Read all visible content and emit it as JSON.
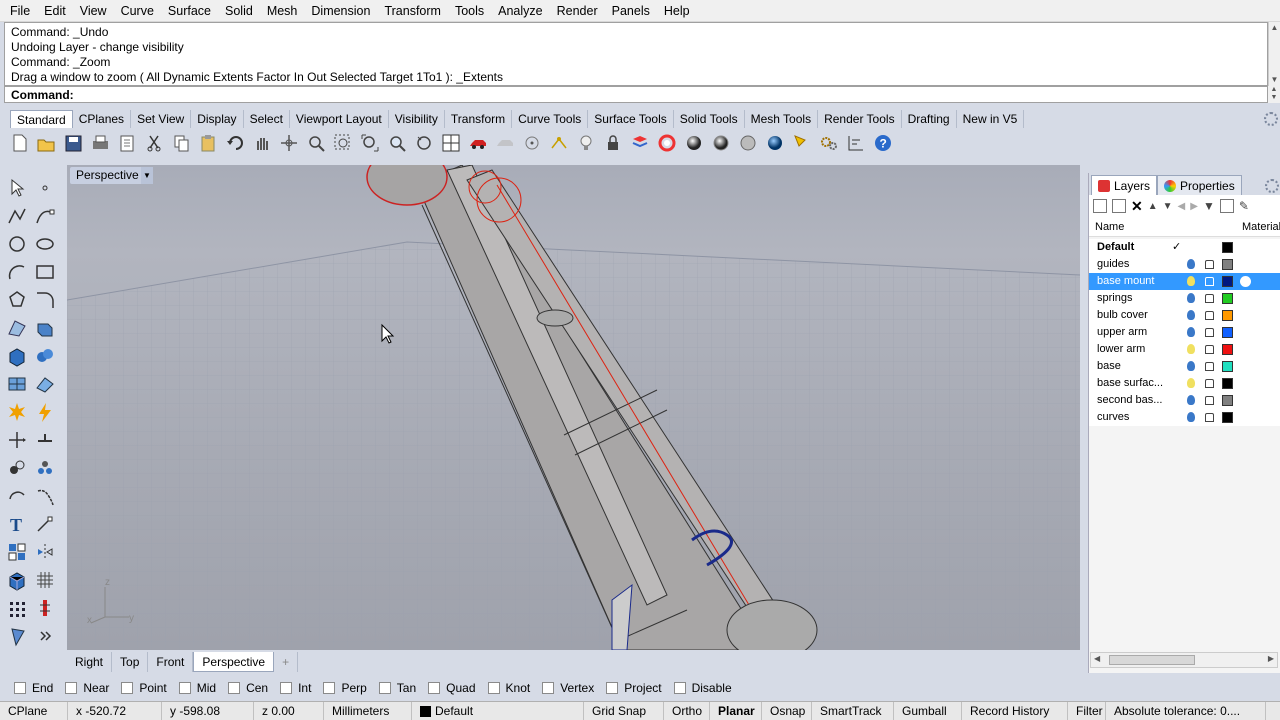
{
  "menu": [
    "File",
    "Edit",
    "View",
    "Curve",
    "Surface",
    "Solid",
    "Mesh",
    "Dimension",
    "Transform",
    "Tools",
    "Analyze",
    "Render",
    "Panels",
    "Help"
  ],
  "history": [
    "Command: _Undo",
    "Undoing Layer - change visibility",
    "Command: _Zoom",
    "Drag a window to zoom ( All  Dynamic  Extents  Factor  In  Out  Selected  Target  1To1 ): _Extents"
  ],
  "command_prompt": "Command:",
  "toolbar_tabs": [
    "Standard",
    "CPlanes",
    "Set View",
    "Display",
    "Select",
    "Viewport Layout",
    "Visibility",
    "Transform",
    "Curve Tools",
    "Surface Tools",
    "Solid Tools",
    "Mesh Tools",
    "Render Tools",
    "Drafting",
    "New in V5"
  ],
  "viewport": {
    "label": "Perspective",
    "dropdown": "▼"
  },
  "view_tabs": [
    "Right",
    "Top",
    "Front",
    "Perspective"
  ],
  "view_tab_add": "+",
  "osnaps": [
    "End",
    "Near",
    "Point",
    "Mid",
    "Cen",
    "Int",
    "Perp",
    "Tan",
    "Quad",
    "Knot",
    "Vertex",
    "Project",
    "Disable"
  ],
  "status": {
    "cplane": "CPlane",
    "x": "x -520.72",
    "y": "y -598.08",
    "z": "z 0.00",
    "units": "Millimeters",
    "layer": "Default",
    "grid_snap": "Grid Snap",
    "ortho": "Ortho",
    "planar": "Planar",
    "osnap": "Osnap",
    "smarttrack": "SmartTrack",
    "gumball": "Gumball",
    "record_history": "Record History",
    "filter": "Filter",
    "tolerance": "Absolute tolerance: 0...."
  },
  "panel": {
    "tabs": [
      "Layers",
      "Properties"
    ],
    "header_name": "Name",
    "header_material": "Material",
    "layers": [
      {
        "name": "Default",
        "bold": true,
        "check": "✓",
        "color": "#000000"
      },
      {
        "name": "guides",
        "bulb": "#3a78c8",
        "color": "#808080"
      },
      {
        "name": "base mount",
        "bulb": "#f0e060",
        "color": "#001880",
        "selected": true
      },
      {
        "name": "springs",
        "bulb": "#3a78c8",
        "color": "#22cc22"
      },
      {
        "name": "bulb cover",
        "bulb": "#3a78c8",
        "color": "#ff9900"
      },
      {
        "name": "upper arm",
        "bulb": "#3a78c8",
        "color": "#1060ff"
      },
      {
        "name": "lower arm",
        "bulb": "#f0e060",
        "color": "#ee1111"
      },
      {
        "name": "base",
        "bulb": "#3a78c8",
        "color": "#20e0c0"
      },
      {
        "name": "base surfac...",
        "bulb": "#f0e060",
        "color": "#000000"
      },
      {
        "name": "second bas...",
        "bulb": "#3a78c8",
        "color": "#808080"
      },
      {
        "name": "curves",
        "bulb": "#3a78c8",
        "color": "#000000"
      }
    ]
  },
  "colors": {
    "accent": "#3399ff",
    "chrome": "#d6dbe6",
    "viewport": "#a8acb8"
  }
}
